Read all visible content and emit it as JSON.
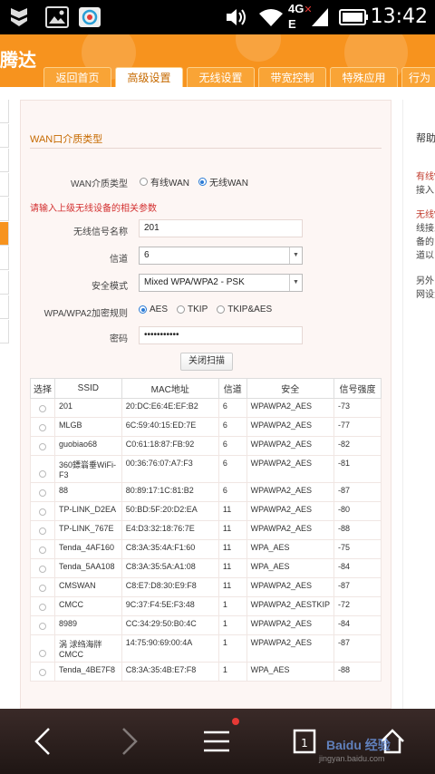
{
  "status_bar": {
    "time": "13:42",
    "network": "4G",
    "network_sub": "E",
    "icons": [
      "shield-icon",
      "image-icon",
      "app-icon",
      "volume-icon",
      "wifi-icon",
      "signal-icon",
      "battery-icon"
    ]
  },
  "header": {
    "logo_text": "腾达",
    "brand_color": "#f7931e",
    "tabs": [
      {
        "label": "返回首页"
      },
      {
        "label": "高级设置"
      },
      {
        "label": "无线设置"
      },
      {
        "label": "带宽控制"
      },
      {
        "label": "特殊应用"
      },
      {
        "label": "行为"
      }
    ],
    "active_tab": "高级设置"
  },
  "form": {
    "section_title": "WAN口介质类型",
    "wan_type_label": "WAN介质类型",
    "wan_type_options": [
      "有线WAN",
      "无线WAN"
    ],
    "wan_type_selected": "无线WAN",
    "hint": "请输入上级无线设备的相关参数",
    "ssid_label": "无线信号名称",
    "ssid_value": "201",
    "channel_label": "信道",
    "channel_value": "6",
    "security_label": "安全模式",
    "security_value": "Mixed WPA/WPA2 - PSK",
    "cipher_label": "WPA/WPA2加密规则",
    "cipher_options": [
      "AES",
      "TKIP",
      "TKIP&AES"
    ],
    "cipher_selected": "AES",
    "password_label": "密码",
    "password_value": "•••••••••••",
    "scan_button": "关闭扫描"
  },
  "table": {
    "headers": [
      "选择",
      "SSID",
      "MAC地址",
      "信道",
      "安全",
      "信号强度"
    ],
    "rows": [
      {
        "ssid": "201",
        "mac": "20:DC:E6:4E:EF:B2",
        "channel": "6",
        "security": "WPAWPA2_AES",
        "signal": "-73"
      },
      {
        "ssid": "MLGB",
        "mac": "6C:59:40:15:ED:7E",
        "channel": "6",
        "security": "WPAWPA2_AES",
        "signal": "-77"
      },
      {
        "ssid": "guobiao68",
        "mac": "C0:61:18:87:FB:92",
        "channel": "6",
        "security": "WPAWPA2_AES",
        "signal": "-82"
      },
      {
        "ssid": "360鏢嵡垂WiFi-F3",
        "mac": "00:36:76:07:A7:F3",
        "channel": "6",
        "security": "WPAWPA2_AES",
        "signal": "-81"
      },
      {
        "ssid": "88",
        "mac": "80:89:17:1C:81:B2",
        "channel": "6",
        "security": "WPAWPA2_AES",
        "signal": "-87"
      },
      {
        "ssid": "TP-LINK_D2EA",
        "mac": "50:BD:5F:20:D2:EA",
        "channel": "11",
        "security": "WPAWPA2_AES",
        "signal": "-80"
      },
      {
        "ssid": "TP-LINK_767E",
        "mac": "E4:D3:32:18:76:7E",
        "channel": "11",
        "security": "WPAWPA2_AES",
        "signal": "-88"
      },
      {
        "ssid": "Tenda_4AF160",
        "mac": "C8:3A:35:4A:F1:60",
        "channel": "11",
        "security": "WPA_AES",
        "signal": "-75"
      },
      {
        "ssid": "Tenda_5AA108",
        "mac": "C8:3A:35:5A:A1:08",
        "channel": "11",
        "security": "WPA_AES",
        "signal": "-84"
      },
      {
        "ssid": "CMSWAN",
        "mac": "C8:E7:D8:30:E9:F8",
        "channel": "11",
        "security": "WPAWPA2_AES",
        "signal": "-87"
      },
      {
        "ssid": "CMCC",
        "mac": "9C:37:F4:5E:F3:48",
        "channel": "1",
        "security": "WPAWPA2_AESTKIP",
        "signal": "-72"
      },
      {
        "ssid": "8989",
        "mac": "CC:34:29:50:B0:4C",
        "channel": "1",
        "security": "WPAWPA2_AES",
        "signal": "-84"
      },
      {
        "ssid": "涡 浗绉海牉CMCC",
        "mac": "14:75:90:69:00:4A",
        "channel": "1",
        "security": "WPAWPA2_AES",
        "signal": "-87"
      },
      {
        "ssid": "Tenda_4BE7F8",
        "mac": "C8:3A:35:4B:E7:F8",
        "channel": "1",
        "security": "WPA_AES",
        "signal": "-88"
      }
    ]
  },
  "help": {
    "title": "帮助",
    "lines": [
      "有线W",
      "接入",
      "无线W",
      "线接入",
      "备的",
      "道以",
      "另外",
      "网设置"
    ]
  },
  "bottom_nav": {
    "watermark": "Baidu 经验",
    "watermark_sub": "jingyan.baidu.com"
  }
}
